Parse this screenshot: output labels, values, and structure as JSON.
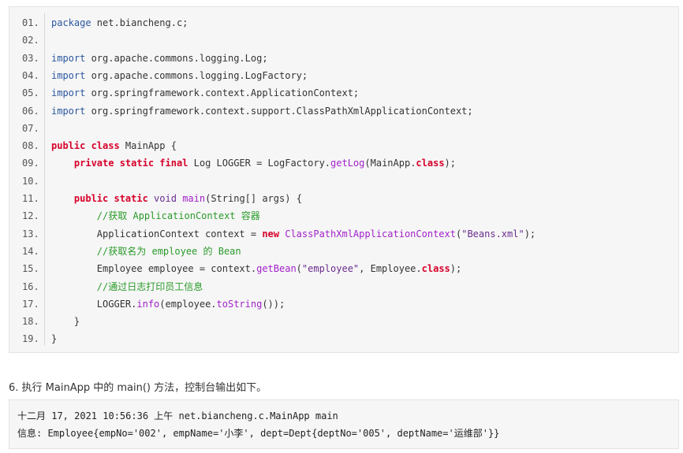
{
  "code_lines": [
    {
      "num": "01.",
      "tokens": [
        {
          "t": "package",
          "c": "pl"
        },
        {
          "t": " net.biancheng.c;",
          "c": "id"
        }
      ]
    },
    {
      "num": "02.",
      "tokens": []
    },
    {
      "num": "03.",
      "tokens": [
        {
          "t": "import",
          "c": "pl"
        },
        {
          "t": " org.apache.commons.logging.Log;",
          "c": "id"
        }
      ]
    },
    {
      "num": "04.",
      "tokens": [
        {
          "t": "import",
          "c": "pl"
        },
        {
          "t": " org.apache.commons.logging.LogFactory;",
          "c": "id"
        }
      ]
    },
    {
      "num": "05.",
      "tokens": [
        {
          "t": "import",
          "c": "pl"
        },
        {
          "t": " org.springframework.context.ApplicationContext;",
          "c": "id"
        }
      ]
    },
    {
      "num": "06.",
      "tokens": [
        {
          "t": "import",
          "c": "pl"
        },
        {
          "t": " org.springframework.context.support.ClassPathXmlApplicationContext;",
          "c": "id"
        }
      ]
    },
    {
      "num": "07.",
      "tokens": []
    },
    {
      "num": "08.",
      "tokens": [
        {
          "t": "public class",
          "c": "kw"
        },
        {
          "t": " MainApp {",
          "c": "id"
        }
      ]
    },
    {
      "num": "09.",
      "tokens": [
        {
          "t": "    ",
          "c": "id"
        },
        {
          "t": "private static final",
          "c": "kw"
        },
        {
          "t": " Log LOGGER = LogFactory.",
          "c": "id"
        },
        {
          "t": "getLog",
          "c": "mt"
        },
        {
          "t": "(MainApp.",
          "c": "id"
        },
        {
          "t": "class",
          "c": "kw"
        },
        {
          "t": ");",
          "c": "id"
        }
      ]
    },
    {
      "num": "10.",
      "tokens": []
    },
    {
      "num": "11.",
      "tokens": [
        {
          "t": "    ",
          "c": "id"
        },
        {
          "t": "public static",
          "c": "kw"
        },
        {
          "t": " void ",
          "c": "str"
        },
        {
          "t": "main",
          "c": "mt"
        },
        {
          "t": "(String[] args) {",
          "c": "id"
        }
      ]
    },
    {
      "num": "12.",
      "tokens": [
        {
          "t": "        ",
          "c": "id"
        },
        {
          "t": "//获取 ApplicationContext 容器",
          "c": "cm"
        }
      ]
    },
    {
      "num": "13.",
      "tokens": [
        {
          "t": "        ApplicationContext context = ",
          "c": "id"
        },
        {
          "t": "new",
          "c": "kw"
        },
        {
          "t": " ",
          "c": "id"
        },
        {
          "t": "ClassPathXmlApplicationContext",
          "c": "mt"
        },
        {
          "t": "(",
          "c": "id"
        },
        {
          "t": "\"Beans.xml\"",
          "c": "str"
        },
        {
          "t": ");",
          "c": "id"
        }
      ]
    },
    {
      "num": "14.",
      "tokens": [
        {
          "t": "        ",
          "c": "id"
        },
        {
          "t": "//获取名为 employee 的 Bean",
          "c": "cm"
        }
      ]
    },
    {
      "num": "15.",
      "tokens": [
        {
          "t": "        Employee employee = context.",
          "c": "id"
        },
        {
          "t": "getBean",
          "c": "mt"
        },
        {
          "t": "(",
          "c": "id"
        },
        {
          "t": "\"employee\"",
          "c": "str"
        },
        {
          "t": ", Employee.",
          "c": "id"
        },
        {
          "t": "class",
          "c": "kw"
        },
        {
          "t": ");",
          "c": "id"
        }
      ]
    },
    {
      "num": "16.",
      "tokens": [
        {
          "t": "        ",
          "c": "id"
        },
        {
          "t": "//通过日志打印员工信息",
          "c": "cm"
        }
      ]
    },
    {
      "num": "17.",
      "tokens": [
        {
          "t": "        LOGGER.",
          "c": "id"
        },
        {
          "t": "info",
          "c": "mt"
        },
        {
          "t": "(employee.",
          "c": "id"
        },
        {
          "t": "toString",
          "c": "mt"
        },
        {
          "t": "());",
          "c": "id"
        }
      ]
    },
    {
      "num": "18.",
      "tokens": [
        {
          "t": "    }",
          "c": "id"
        }
      ]
    },
    {
      "num": "19.",
      "tokens": [
        {
          "t": "}",
          "c": "id"
        }
      ]
    }
  ],
  "description": "6. 执行 MainApp 中的 main() 方法，控制台输出如下。",
  "console_output": [
    "十二月 17, 2021 10:56:36 上午 net.biancheng.c.MainApp main",
    "信息: Employee{empNo='002', empName='小李', dept=Dept{deptNo='005', deptName='运维部'}}"
  ]
}
